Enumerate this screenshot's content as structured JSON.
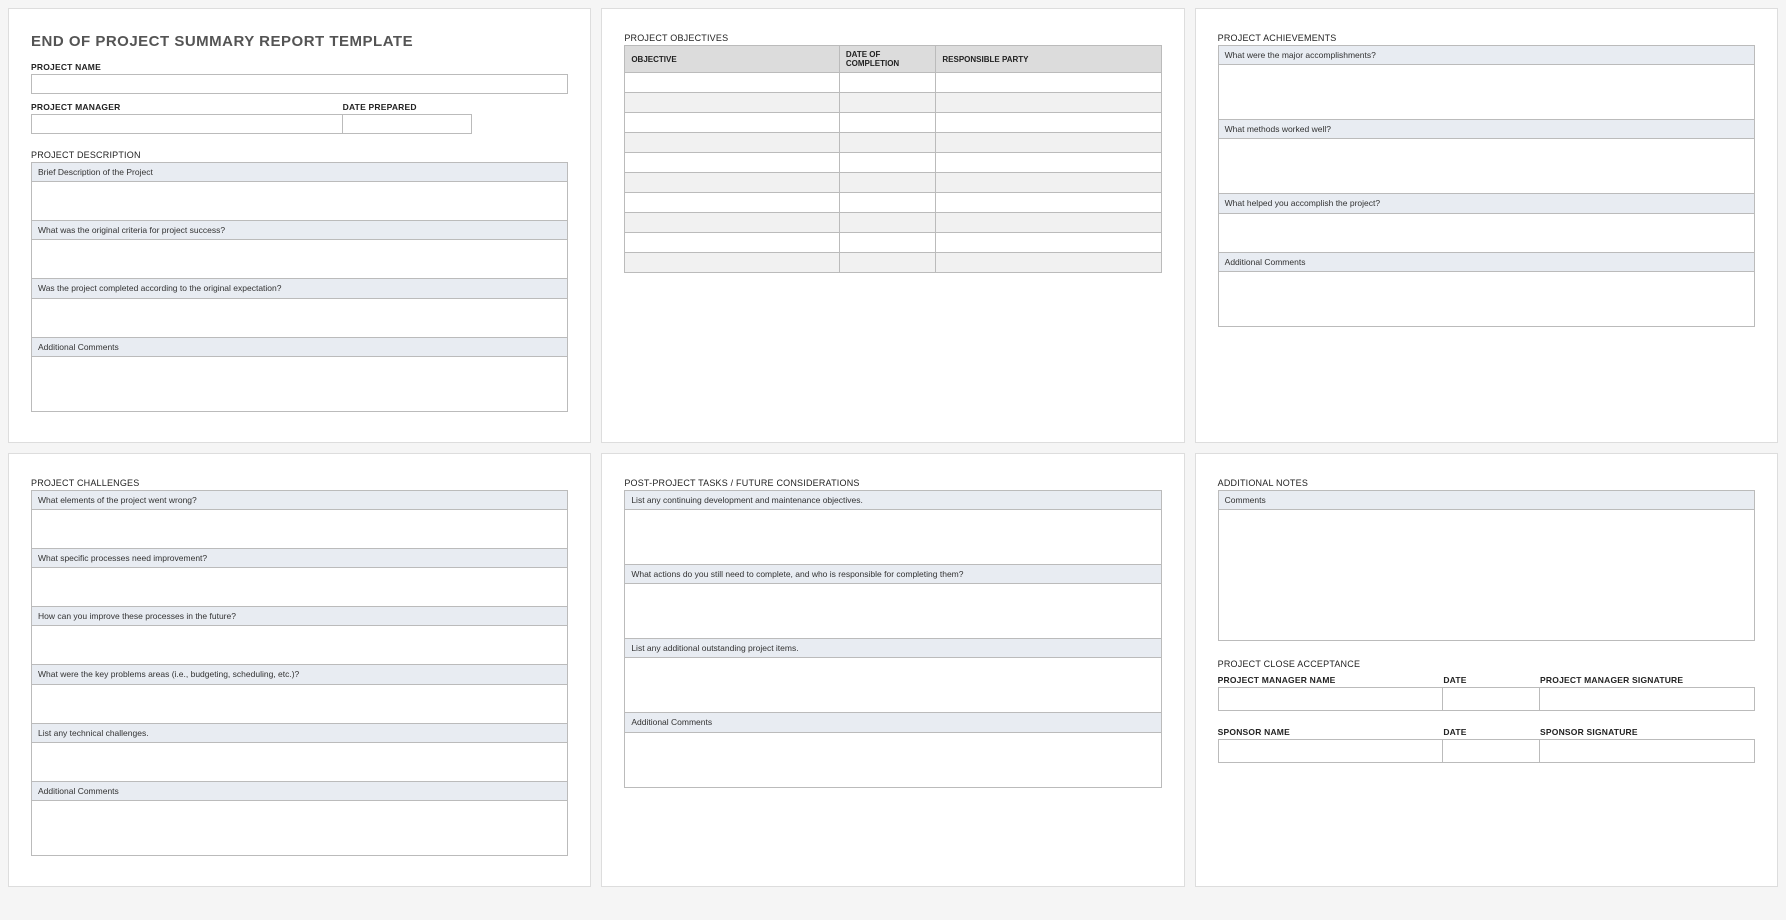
{
  "page1": {
    "title": "END OF PROJECT SUMMARY REPORT TEMPLATE",
    "labels": {
      "project_name": "PROJECT NAME",
      "project_manager": "PROJECT MANAGER",
      "date_prepared": "DATE PREPARED",
      "project_description": "PROJECT DESCRIPTION"
    },
    "desc_questions": [
      "Brief Description of the Project",
      "What was the original criteria for project success?",
      "Was the project completed according to the original expectation?",
      "Additional Comments"
    ]
  },
  "page2": {
    "section": "PROJECT OBJECTIVES",
    "headers": {
      "objective": "OBJECTIVE",
      "date": "DATE OF COMPLETION",
      "party": "RESPONSIBLE PARTY"
    }
  },
  "page3": {
    "section": "PROJECT ACHIEVEMENTS",
    "questions": [
      "What were the major accomplishments?",
      "What methods worked well?",
      "What helped you accomplish the project?",
      "Additional Comments"
    ]
  },
  "page4": {
    "section": "PROJECT CHALLENGES",
    "questions": [
      "What elements of the project went wrong?",
      "What specific processes need improvement?",
      "How can you improve these processes in the future?",
      "What were the key problems areas (i.e., budgeting, scheduling, etc.)?",
      "List any technical challenges.",
      "Additional Comments"
    ]
  },
  "page5": {
    "section": "POST-PROJECT TASKS / FUTURE CONSIDERATIONS",
    "questions": [
      "List any continuing development and maintenance objectives.",
      "What actions do you still need to complete, and who is responsible for completing them?",
      "List any additional outstanding project items.",
      "Additional Comments"
    ]
  },
  "page6": {
    "section_notes": "ADDITIONAL NOTES",
    "notes_q": "Comments",
    "section_close": "PROJECT CLOSE ACCEPTANCE",
    "labels": {
      "pm_name": "PROJECT MANAGER NAME",
      "date": "DATE",
      "pm_sig": "PROJECT MANAGER SIGNATURE",
      "sponsor_name": "SPONSOR NAME",
      "sponsor_sig": "SPONSOR SIGNATURE"
    }
  }
}
